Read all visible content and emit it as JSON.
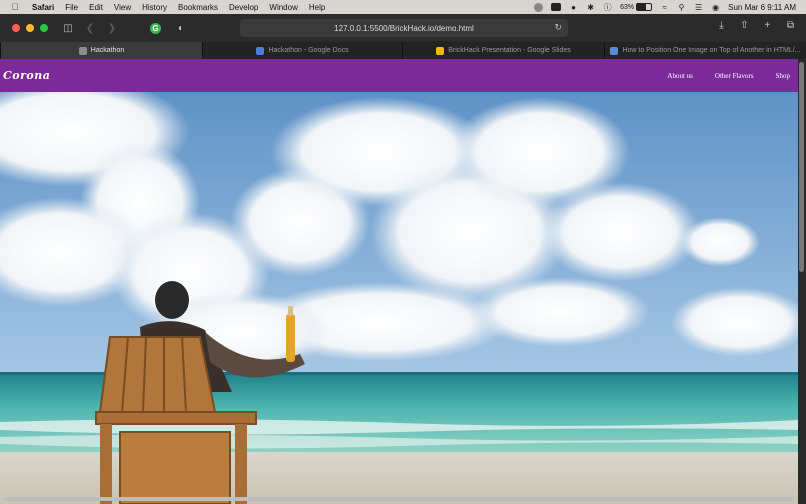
{
  "menubar": {
    "app_name": "Safari",
    "items": [
      "File",
      "Edit",
      "View",
      "History",
      "Bookmarks",
      "Develop",
      "Window",
      "Help"
    ],
    "battery_percent": "63%",
    "battery_level": 0.63,
    "datetime": "Sun Mar 6  9:11 AM"
  },
  "toolbar": {
    "url": "127.0.0.1:5500/BrickHack.io/demo.html"
  },
  "tabs": [
    {
      "label": "Hackathon",
      "active": true,
      "color": "#8c8c8c"
    },
    {
      "label": "Hackathon - Google Docs",
      "active": false,
      "color": "#4a7ee0"
    },
    {
      "label": "BrickHack Presentation - Google Slides",
      "active": false,
      "color": "#f2b705"
    },
    {
      "label": "How to Position One Image on Top of Another in HTML/...",
      "active": false,
      "color": "#5a8bd0"
    }
  ],
  "site": {
    "logo": "Corona",
    "nav": [
      "About us",
      "Other Flavors",
      "Shop"
    ],
    "brand_color": "#7b2a9a"
  }
}
